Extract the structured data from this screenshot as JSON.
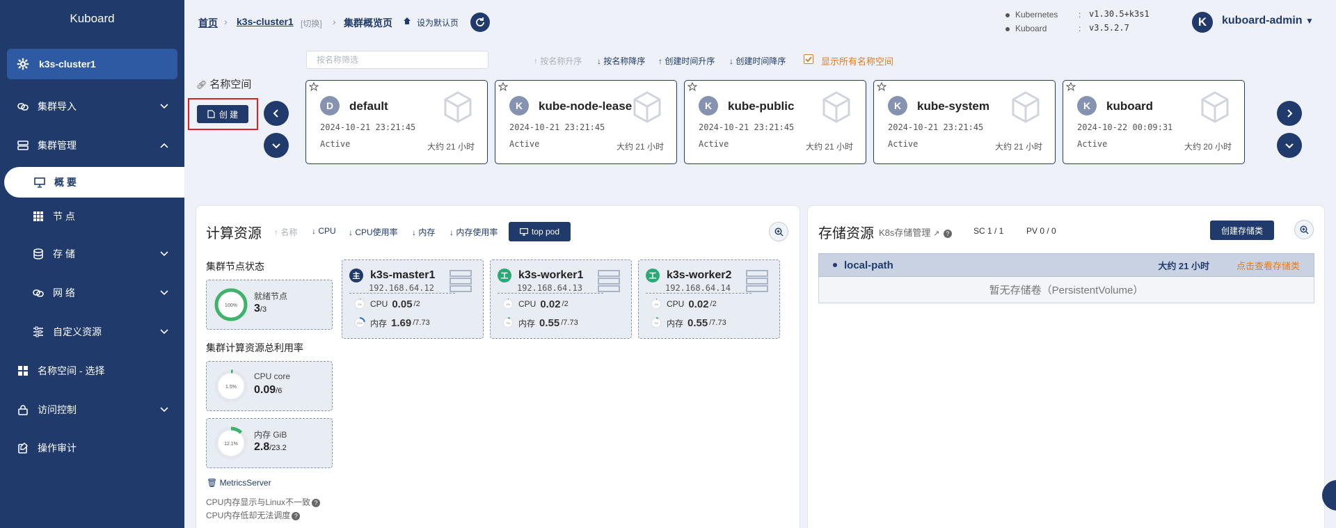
{
  "app": {
    "brand": "Kuboard"
  },
  "sidebar": {
    "cluster": "k3s-cluster1",
    "items": [
      {
        "label": "集群导入"
      },
      {
        "label": "集群管理"
      },
      {
        "label": "概 要"
      },
      {
        "label": "节 点"
      },
      {
        "label": "存 储"
      },
      {
        "label": "网 络"
      },
      {
        "label": "自定义资源"
      },
      {
        "label": "名称空间 - 选择"
      },
      {
        "label": "访问控制"
      },
      {
        "label": "操作审计"
      }
    ]
  },
  "header": {
    "breadcrumb": {
      "home": "首页",
      "cluster": "k3s-cluster1",
      "switch": "[切换]",
      "page": "集群概览页",
      "set_default": "设为默认页"
    },
    "versions": [
      {
        "name": "Kubernetes",
        "value": "v1.30.5+k3s1"
      },
      {
        "name": "Kuboard",
        "value": "v3.5.2.7"
      }
    ],
    "user": {
      "initial": "K",
      "name": "kuboard-admin"
    }
  },
  "namespaces": {
    "title": "名称空间",
    "create_label": "创 建",
    "filter_placeholder": "按名称筛选",
    "sorts": [
      "按名称升序",
      "按名称降序",
      "创建时间升序",
      "创建时间降序"
    ],
    "show_all_label": "显示所有名称空间",
    "cards": [
      {
        "letter": "D",
        "name": "default",
        "created": "2024-10-21 23:21:45",
        "status": "Active",
        "age": "大约 21 小时"
      },
      {
        "letter": "K",
        "name": "kube-node-lease",
        "created": "2024-10-21 23:21:45",
        "status": "Active",
        "age": "大约 21 小时"
      },
      {
        "letter": "K",
        "name": "kube-public",
        "created": "2024-10-21 23:21:45",
        "status": "Active",
        "age": "大约 21 小时"
      },
      {
        "letter": "K",
        "name": "kube-system",
        "created": "2024-10-21 23:21:45",
        "status": "Active",
        "age": "大约 21 小时"
      },
      {
        "letter": "K",
        "name": "kuboard",
        "created": "2024-10-22 00:09:31",
        "status": "Active",
        "age": "大约 20 小时"
      }
    ]
  },
  "compute": {
    "title": "计算资源",
    "sorts": [
      "名称",
      "CPU",
      "CPU使用率",
      "内存",
      "内存使用率"
    ],
    "top_pod": "top pod",
    "node_status_title": "集群节点状态",
    "ready": {
      "pct": "100%",
      "label": "就绪节点",
      "value": "3",
      "total": "/3",
      "fraction": 1.0
    },
    "utilization_title": "集群计算资源总利用率",
    "cpu": {
      "pct": "1.5%",
      "label": "CPU core",
      "value": "0.09",
      "total": "/6",
      "fraction": 0.015
    },
    "mem": {
      "pct": "12.1%",
      "label": "内存 GiB",
      "value": "2.8",
      "total": "/23.2",
      "fraction": 0.121
    },
    "nodes": [
      {
        "role": "主",
        "role_color": "#1f3a6b",
        "name": "k3s-master1",
        "ip": "192.168.64.12",
        "cpu_pct": "2%",
        "cpu_label": "CPU",
        "cpu": "0.05",
        "cpu_total": "/2",
        "cpu_frac": 0.02,
        "mem_pct": "22%",
        "mem_label": "内存",
        "mem": "1.69",
        "mem_total": "/7.73",
        "mem_frac": 0.22
      },
      {
        "role": "工",
        "role_color": "#2aa876",
        "name": "k3s-worker1",
        "ip": "192.168.64.13",
        "cpu_pct": "1%",
        "cpu_label": "CPU",
        "cpu": "0.02",
        "cpu_total": "/2",
        "cpu_frac": 0.01,
        "mem_pct": "7%",
        "mem_label": "内存",
        "mem": "0.55",
        "mem_total": "/7.73",
        "mem_frac": 0.07
      },
      {
        "role": "工",
        "role_color": "#2aa876",
        "name": "k3s-worker2",
        "ip": "192.168.64.14",
        "cpu_pct": "1%",
        "cpu_label": "CPU",
        "cpu": "0.02",
        "cpu_total": "/2",
        "cpu_frac": 0.01,
        "mem_pct": "7%",
        "mem_label": "内存",
        "mem": "0.55",
        "mem_total": "/7.73",
        "mem_frac": 0.07
      }
    ],
    "metrics_server": "MetricsServer",
    "notes": [
      "CPU内存显示与Linux不一致",
      "CPU内存低却无法调度"
    ]
  },
  "storage": {
    "title": "存储资源",
    "k8s_link": "K8s存储管理",
    "sc_count": "SC 1 / 1",
    "pv_count": "PV 0 / 0",
    "create_label": "创建存储类",
    "classes": [
      {
        "name": "local-path",
        "age": "大约 21 小时",
        "link": "点击查看存储类",
        "empty": "暂无存储卷（PersistentVolume）"
      }
    ]
  },
  "colors": {
    "primary": "#1f3a6b",
    "accent": "#e07a1e",
    "ready_green": "#3fb36b"
  }
}
